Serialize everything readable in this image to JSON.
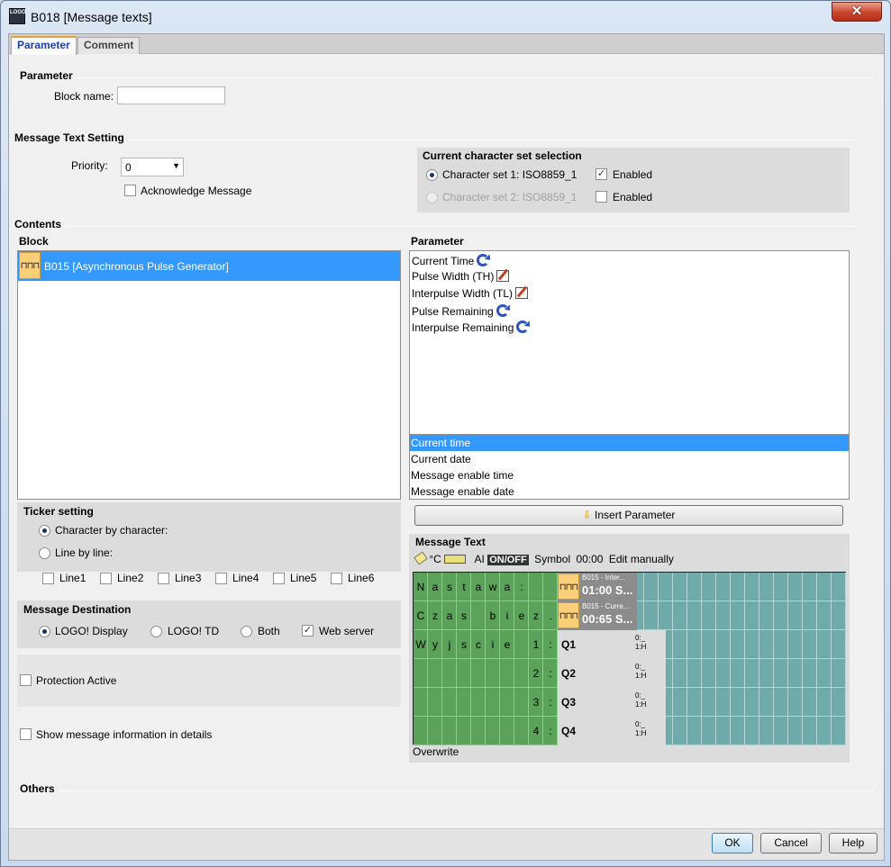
{
  "window": {
    "title": "B018 [Message texts]",
    "app_icon_text": "LOGO",
    "close_glyph": "✕"
  },
  "tabs": [
    {
      "label": "Parameter",
      "active": true
    },
    {
      "label": "Comment",
      "active": false
    }
  ],
  "parameter_section": {
    "title": "Parameter",
    "block_name_label": "Block name:",
    "block_name_value": ""
  },
  "message_text_setting": {
    "title": "Message Text Setting",
    "priority_label": "Priority:",
    "priority_value": "0",
    "acknowledge_label": "Acknowledge Message",
    "acknowledge_checked": false
  },
  "charset": {
    "title": "Current character set selection",
    "set1_label": "Character set 1: ISO8859_1",
    "set1_selected": true,
    "set1_enabled_label": "Enabled",
    "set1_enabled_checked": true,
    "set2_label": "Character set 2: ISO8859_1",
    "set2_selected": false,
    "set2_enabled_label": "Enabled",
    "set2_enabled_checked": false
  },
  "contents": {
    "title": "Contents",
    "block_header": "Block",
    "block_items": [
      {
        "label": "B015 [Asynchronous Pulse Generator]",
        "selected": true
      }
    ],
    "parameter_header": "Parameter",
    "parameter_items": [
      {
        "label": "Current Time",
        "icon": "refresh-icon"
      },
      {
        "label": "Pulse Width (TH)",
        "icon": "edit-icon"
      },
      {
        "label": "Interpulse Width (TL)",
        "icon": "edit-icon"
      },
      {
        "label": "Pulse Remaining",
        "icon": "refresh-icon"
      },
      {
        "label": "Interpulse Remaining",
        "icon": "refresh-icon"
      }
    ],
    "time_items": [
      {
        "label": "Current time",
        "selected": true
      },
      {
        "label": "Current date",
        "selected": false
      },
      {
        "label": "Message enable time",
        "selected": false
      },
      {
        "label": "Message enable date",
        "selected": false
      }
    ],
    "insert_parameter_label": "Insert Parameter"
  },
  "ticker": {
    "title": "Ticker setting",
    "char_by_char_label": "Character by character:",
    "char_by_char_selected": true,
    "line_by_line_label": "Line by line:",
    "line_by_line_selected": false,
    "lines": [
      "Line1",
      "Line2",
      "Line3",
      "Line4",
      "Line5",
      "Line6"
    ]
  },
  "destination": {
    "title": "Message Destination",
    "options": [
      {
        "label": "LOGO! Display",
        "type": "radio",
        "checked": true
      },
      {
        "label": "LOGO! TD",
        "type": "radio",
        "checked": false
      },
      {
        "label": "Both",
        "type": "radio",
        "checked": false
      },
      {
        "label": "Web server",
        "type": "checkbox",
        "checked": true
      }
    ]
  },
  "protection": {
    "label": "Protection Active",
    "checked": false
  },
  "show_info": {
    "label": "Show message information in details",
    "checked": false
  },
  "message_text": {
    "title": "Message Text",
    "toolbar": {
      "degc": "°C",
      "ai": "AI",
      "onoff": "ON/OFF",
      "symbol": "Symbol",
      "time": "00:00",
      "edit_manually": "Edit manually"
    },
    "rows": [
      {
        "chars": [
          "N",
          "a",
          "s",
          "t",
          "a",
          "w",
          "a",
          ":"
        ]
      },
      {
        "chars": [
          "C",
          "z",
          "a",
          "s",
          "",
          "b",
          "i",
          "e",
          "z",
          "."
        ]
      },
      {
        "chars": [
          "W",
          "y",
          "j",
          "s",
          "c",
          "i",
          "e",
          "",
          "1",
          ":"
        ]
      },
      {
        "chars": [
          "",
          "",
          "",
          "",
          "",
          "",
          "",
          "",
          "2",
          ":"
        ]
      },
      {
        "chars": [
          "",
          "",
          "",
          "",
          "",
          "",
          "",
          "",
          "3",
          ":"
        ]
      },
      {
        "chars": [
          "",
          "",
          "",
          "",
          "",
          "",
          "",
          "",
          "4",
          ":"
        ]
      }
    ],
    "chips": [
      {
        "small": "B015 - Inter...",
        "big": "01:00 S..."
      },
      {
        "small": "B015 - Curre...",
        "big": "00:65 S..."
      }
    ],
    "outputs": [
      {
        "label": "Q1",
        "mini1": "0:_",
        "mini2": "1:H"
      },
      {
        "label": "Q2",
        "mini1": "0:_",
        "mini2": "1:H"
      },
      {
        "label": "Q3",
        "mini1": "0:_",
        "mini2": "1:H"
      },
      {
        "label": "Q4",
        "mini1": "0:_",
        "mini2": "1:H"
      }
    ],
    "mode_label": "Overwrite"
  },
  "others": {
    "title": "Others"
  },
  "footer": {
    "ok": "OK",
    "cancel": "Cancel",
    "help": "Help"
  }
}
